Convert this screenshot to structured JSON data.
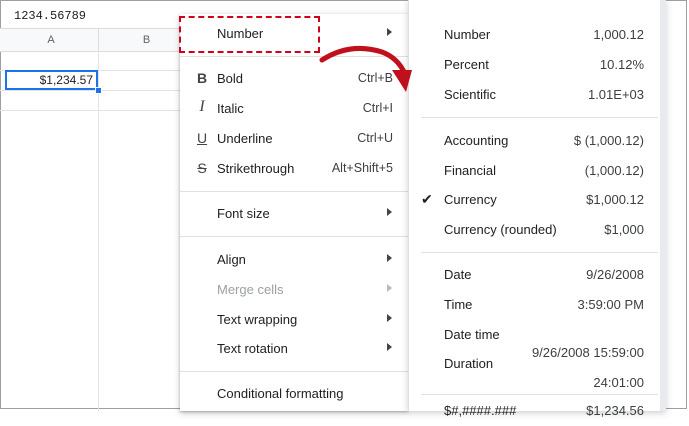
{
  "formula_bar": {
    "value": "1234.56789"
  },
  "columns": [
    "A",
    "B"
  ],
  "selected_cell": {
    "display": "$1,234.57"
  },
  "format_menu": {
    "number": "Number",
    "bold": {
      "label": "Bold",
      "shortcut": "Ctrl+B"
    },
    "italic": {
      "label": "Italic",
      "shortcut": "Ctrl+I"
    },
    "underline": {
      "label": "Underline",
      "shortcut": "Ctrl+U"
    },
    "strikethrough": {
      "label": "Strikethrough",
      "shortcut": "Alt+Shift+5"
    },
    "font_size": "Font size",
    "align": "Align",
    "merge_cells": "Merge cells",
    "text_wrapping": "Text wrapping",
    "text_rotation": "Text rotation",
    "conditional_formatting": "Conditional formatting"
  },
  "number_submenu": {
    "number": {
      "label": "Number",
      "example": "1,000.12"
    },
    "percent": {
      "label": "Percent",
      "example": "10.12%"
    },
    "scientific": {
      "label": "Scientific",
      "example": "1.01E+03"
    },
    "accounting": {
      "label": "Accounting",
      "example": "$ (1,000.12)"
    },
    "financial": {
      "label": "Financial",
      "example": "(1,000.12)"
    },
    "currency": {
      "label": "Currency",
      "example": "$1,000.12",
      "checked": true
    },
    "currency_rounded": {
      "label": "Currency (rounded)",
      "example": "$1,000"
    },
    "date": {
      "label": "Date",
      "example": "9/26/2008"
    },
    "time": {
      "label": "Time",
      "example": "3:59:00 PM"
    },
    "date_time": {
      "label": "Date time",
      "example": "9/26/2008 15:59:00"
    },
    "duration": {
      "label": "Duration",
      "example": "24:01:00"
    },
    "partial": {
      "label": "$#,####.###",
      "example": "$1,234.56"
    }
  },
  "colors": {
    "highlight": "#d0021b",
    "selection": "#1a73e8"
  },
  "icons": [
    "bold-icon",
    "italic-icon",
    "underline-icon",
    "strikethrough-icon",
    "checkmark-icon",
    "submenu-arrow-icon",
    "curved-arrow"
  ]
}
